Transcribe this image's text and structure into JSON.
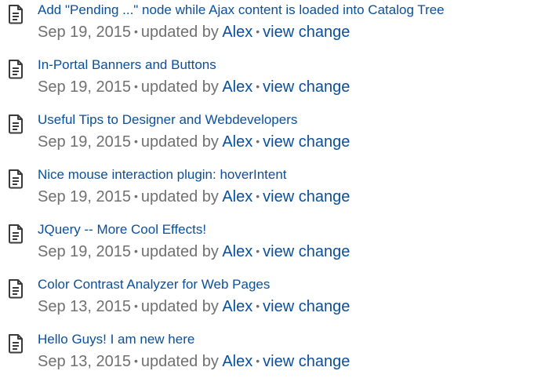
{
  "updates": [
    {
      "title": "Add \"Pending ...\" node while Ajax content is loaded into Catalog Tree",
      "date": "Sep 19, 2015",
      "updated_by_label": "updated by",
      "author": "Alex",
      "change_link": "view change",
      "icon": "page-icon"
    },
    {
      "title": "In-Portal Banners and Buttons",
      "date": "Sep 19, 2015",
      "updated_by_label": "updated by",
      "author": "Alex",
      "change_link": "view change",
      "icon": "page-icon"
    },
    {
      "title": "Useful Tips to Designer and Webdevelopers",
      "date": "Sep 19, 2015",
      "updated_by_label": "updated by",
      "author": "Alex",
      "change_link": "view change",
      "icon": "page-icon"
    },
    {
      "title": "Nice mouse interaction plugin: hoverIntent",
      "date": "Sep 19, 2015",
      "updated_by_label": "updated by",
      "author": "Alex",
      "change_link": "view change",
      "icon": "page-icon"
    },
    {
      "title": "JQuery -- More Cool Effects!",
      "date": "Sep 19, 2015",
      "updated_by_label": "updated by",
      "author": "Alex",
      "change_link": "view change",
      "icon": "page-icon"
    },
    {
      "title": "Color Contrast Analyzer for Web Pages",
      "date": "Sep 13, 2015",
      "updated_by_label": "updated by",
      "author": "Alex",
      "change_link": "view change",
      "icon": "page-icon"
    },
    {
      "title": "Hello Guys! I am new here",
      "date": "Sep 13, 2015",
      "updated_by_label": "updated by",
      "author": "Alex",
      "change_link": "view change",
      "icon": "page-icon"
    }
  ],
  "separator": "•",
  "colors": {
    "link": "#0b4f9a",
    "meta_text": "#707070",
    "icon_stroke": "#3a3a3a"
  }
}
